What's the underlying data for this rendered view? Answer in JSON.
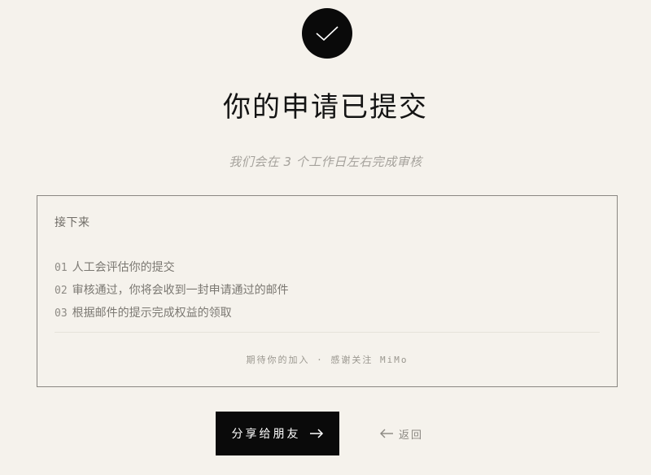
{
  "header": {
    "check_icon": "check-icon",
    "title": "你的申请已提交",
    "subtitle": "我们会在 3 个工作日左右完成审核"
  },
  "next_steps": {
    "heading": "接下来",
    "steps": [
      {
        "num": "01",
        "text": "人工会评估你的提交"
      },
      {
        "num": "02",
        "text": "审核通过，你将会收到一封申请通过的邮件"
      },
      {
        "num": "03",
        "text": "根据邮件的提示完成权益的领取"
      }
    ],
    "footer": "期待你的加入 · 感谢关注 MiMo"
  },
  "actions": {
    "share_label": "分享给朋友",
    "share_icon": "arrow-right-icon",
    "back_label": "返回",
    "back_icon": "arrow-left-icon"
  },
  "colors": {
    "background": "#f5f2ec",
    "accent": "#0a0a0a",
    "muted_text": "#a5a29c",
    "border": "#8a8782"
  }
}
